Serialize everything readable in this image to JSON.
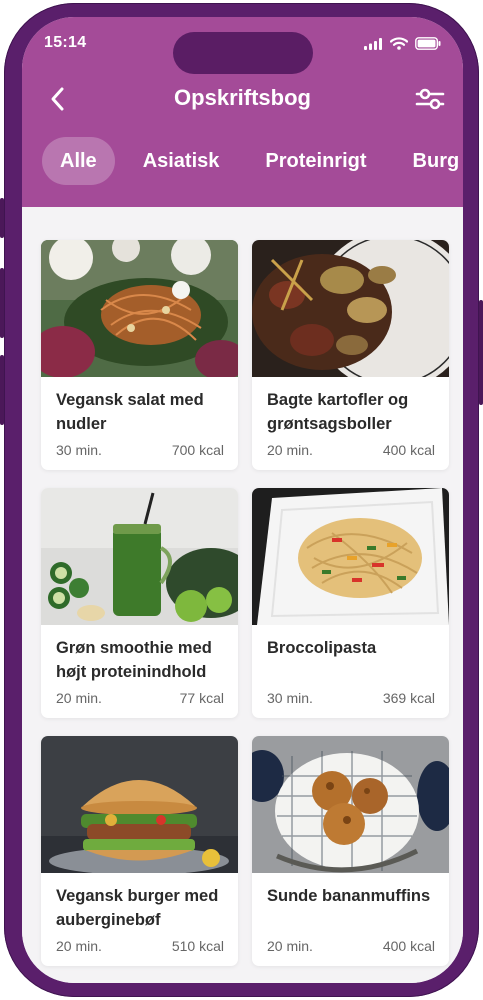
{
  "status_bar": {
    "time": "15:14"
  },
  "header": {
    "title": "Opskriftsbog",
    "back_icon": "chevron-left-icon",
    "filter_icon": "sliders-icon",
    "background": "#a44b98"
  },
  "categories": [
    {
      "label": "Alle",
      "active": true
    },
    {
      "label": "Asiatisk",
      "active": false
    },
    {
      "label": "Proteinrigt",
      "active": false
    },
    {
      "label": "Burg",
      "active": false
    }
  ],
  "recipes": [
    {
      "title": "Vegansk salat med nudler",
      "time": "30 min.",
      "kcal": "700 kcal"
    },
    {
      "title": "Bagte kartofler og grøntsagsboller",
      "time": "20 min.",
      "kcal": "400 kcal"
    },
    {
      "title": "Grøn smoothie med højt proteinindhold",
      "time": "20 min.",
      "kcal": "77 kcal"
    },
    {
      "title": "Broccolipasta",
      "time": "30 min.",
      "kcal": "369 kcal"
    },
    {
      "title": "Vegansk burger med auberginebøf",
      "time": "20 min.",
      "kcal": "510 kcal"
    },
    {
      "title": "Sunde bananmuffins",
      "time": "20 min.",
      "kcal": "400 kcal"
    }
  ]
}
